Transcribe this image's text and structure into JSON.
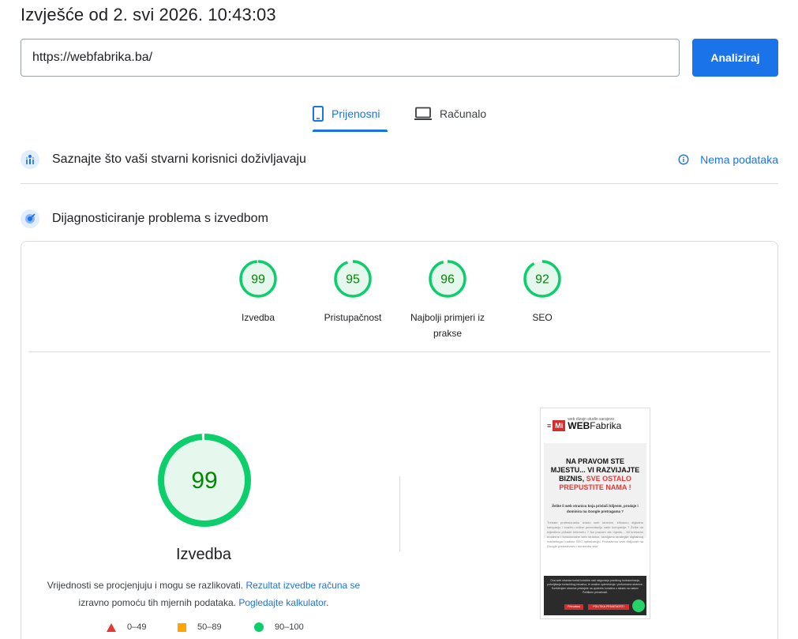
{
  "header": {
    "title": "Izvješće od 2. svi 2026. 10:43:03"
  },
  "search": {
    "url_value": "https://webfabrika.ba/",
    "analyze_label": "Analiziraj"
  },
  "tabs": [
    {
      "label": "Prijenosni",
      "icon": "mobile-icon",
      "active": true
    },
    {
      "label": "Računalo",
      "icon": "desktop-icon",
      "active": false
    }
  ],
  "field_data": {
    "title": "Saznajte što vaši stvarni korisnici doživljavaju",
    "status": "Nema podataka"
  },
  "diagnostics": {
    "title": "Dijagnosticiranje problema s izvedbom",
    "categories": [
      {
        "label": "Izvedba",
        "score": "99"
      },
      {
        "label": "Pristupačnost",
        "score": "95"
      },
      {
        "label": "Najbolji primjeri iz prakse",
        "score": "96"
      },
      {
        "label": "SEO",
        "score": "92"
      }
    ],
    "main_score": "99",
    "main_label": "Izvedba",
    "note_text": "Vrijednosti se procjenjuju i mogu se razlikovati.",
    "note_link1": "Rezultat izvedbe računa se",
    "note_text2": "izravno pomoću tih mjernih podataka.",
    "note_link2": "Pogledajte kalkulator",
    "note_end": ".",
    "legend": [
      {
        "label": "0–49",
        "shape": "triangle",
        "color": "#e53935"
      },
      {
        "label": "50–89",
        "shape": "square",
        "color": "#ffa400"
      },
      {
        "label": "90–100",
        "shape": "circle",
        "color": "#0cce6b"
      }
    ]
  },
  "screenshot": {
    "logo_tag": "web dizajn studio sarajevo",
    "logo_mark": "Mi",
    "logo_web": "WEB",
    "logo_fabrika": "Fabrika",
    "menu_glyph": "≡",
    "heading_line1": "NA PRAVOM STE",
    "heading_line2": "MJESTU... VI RAZVIJAJTE",
    "heading_line3a": "BIZNIS,",
    "heading_line3b": "SVE OSTALO",
    "heading_line4": "PREPUSTITE NAMA !",
    "sub": "Želite li web stranicu koja privlači klijente, prodaje i dominira na Google pretragama ?",
    "body": "Trebate profesionalnu izradu web stranice, efikasnu digitalnu kampanju i snažnu online prezentaciju vaše kompanije ? Želite da klijentima prikaže internetu ? Na pravom ste mjestu... Mi kreiramo moderne i funkcionalne web stranice, razvijamo strategije digitalnog marketinga i radimo SEO optimizaciju. Pomažemo vam vidljivosti na Google pretraživaču i donesimo više",
    "cookie_text": "Ova web stranica koristi kolačiće radi osiguranja pravilnog funkcioniranja, poboljšanja korisničkog iskustva, te analize opterećenja i performansi stranice. Korištenjem stranice pristajete na upotrebu kolačića u skladu sa našom Politikom privatnosti.",
    "cookie_btn1": "Prihvatam",
    "cookie_btn2": "POLITIKA PRIVATNOSTI"
  },
  "colors": {
    "accent": "#1a73e8",
    "pass": "#0cce6b",
    "pass_text": "#008800",
    "pass_fill": "#e6f8ee"
  }
}
